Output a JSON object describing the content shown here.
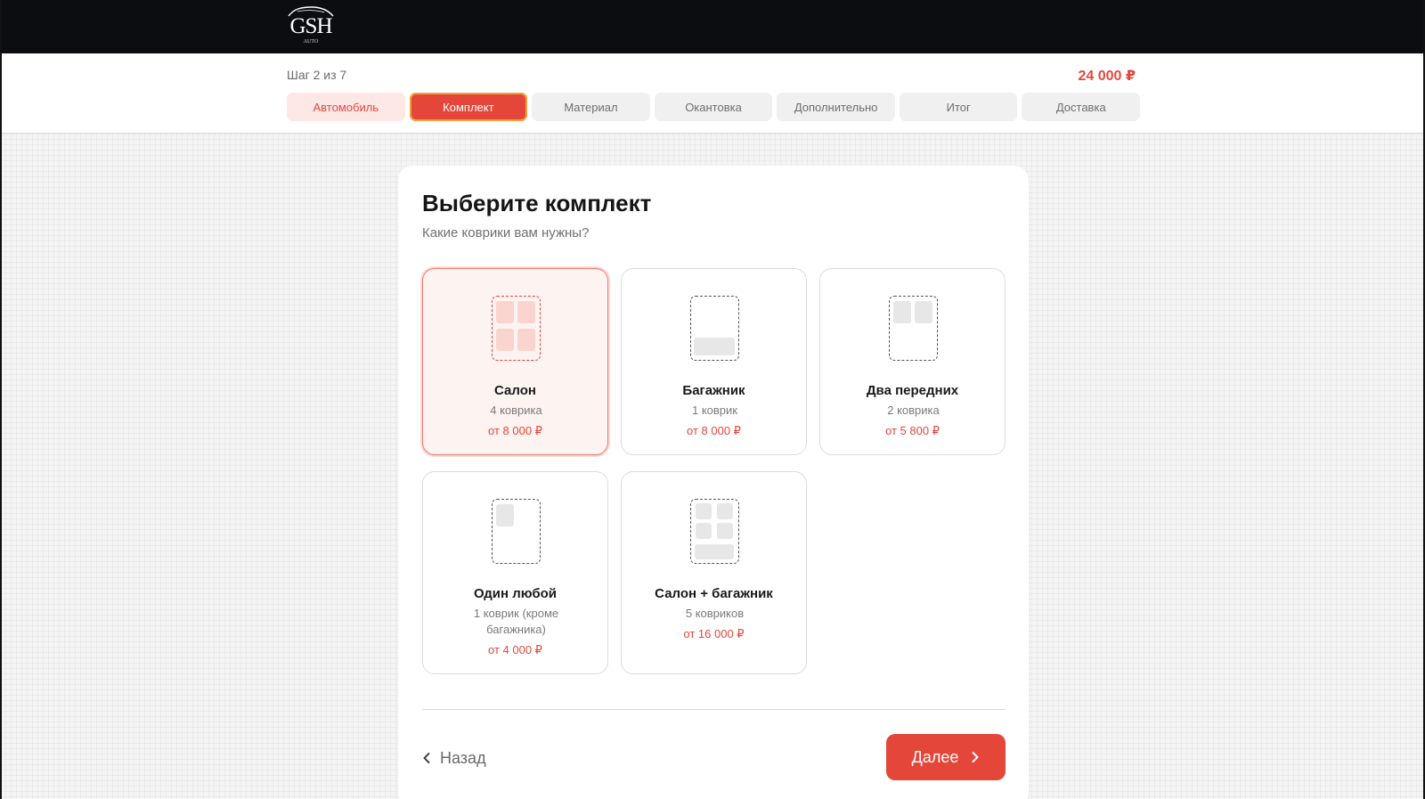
{
  "brand": {
    "logo_text": "GSH",
    "logo_sub": "AUTO"
  },
  "header": {
    "step_label": "Шаг 2 из 7",
    "total_price": "24 000 ₽",
    "steps": [
      {
        "label": "Автомобиль",
        "state": "done"
      },
      {
        "label": "Комплект",
        "state": "active"
      },
      {
        "label": "Материал",
        "state": "pending"
      },
      {
        "label": "Окантовка",
        "state": "pending"
      },
      {
        "label": "Дополнительно",
        "state": "pending"
      },
      {
        "label": "Итог",
        "state": "pending"
      },
      {
        "label": "Доставка",
        "state": "pending"
      }
    ]
  },
  "main": {
    "title": "Выберите комплект",
    "subtitle": "Какие коврики вам нужны?",
    "options": [
      {
        "name": "Салон",
        "count": "4 коврика",
        "price": "от 8 000 ₽",
        "selected": true,
        "icon": "cabin-mats-icon"
      },
      {
        "name": "Багажник",
        "count": "1 коврик",
        "price": "от 8 000 ₽",
        "selected": false,
        "icon": "trunk-mat-icon"
      },
      {
        "name": "Два передних",
        "count": "2 коврика",
        "price": "от 5 800 ₽",
        "selected": false,
        "icon": "front-mats-icon"
      },
      {
        "name": "Один любой",
        "count": "1 коврик (кроме багажника)",
        "price": "от 4 000 ₽",
        "selected": false,
        "icon": "single-mat-icon"
      },
      {
        "name": "Салон + багажник",
        "count": "5 ковриков",
        "price": "от 16 000 ₽",
        "selected": false,
        "icon": "cabin-trunk-mats-icon"
      }
    ],
    "back_label": "Назад",
    "next_label": "Далее"
  },
  "colors": {
    "accent": "#e5463a",
    "accent_light": "#fde8e6",
    "topbar": "#0c0d10"
  }
}
